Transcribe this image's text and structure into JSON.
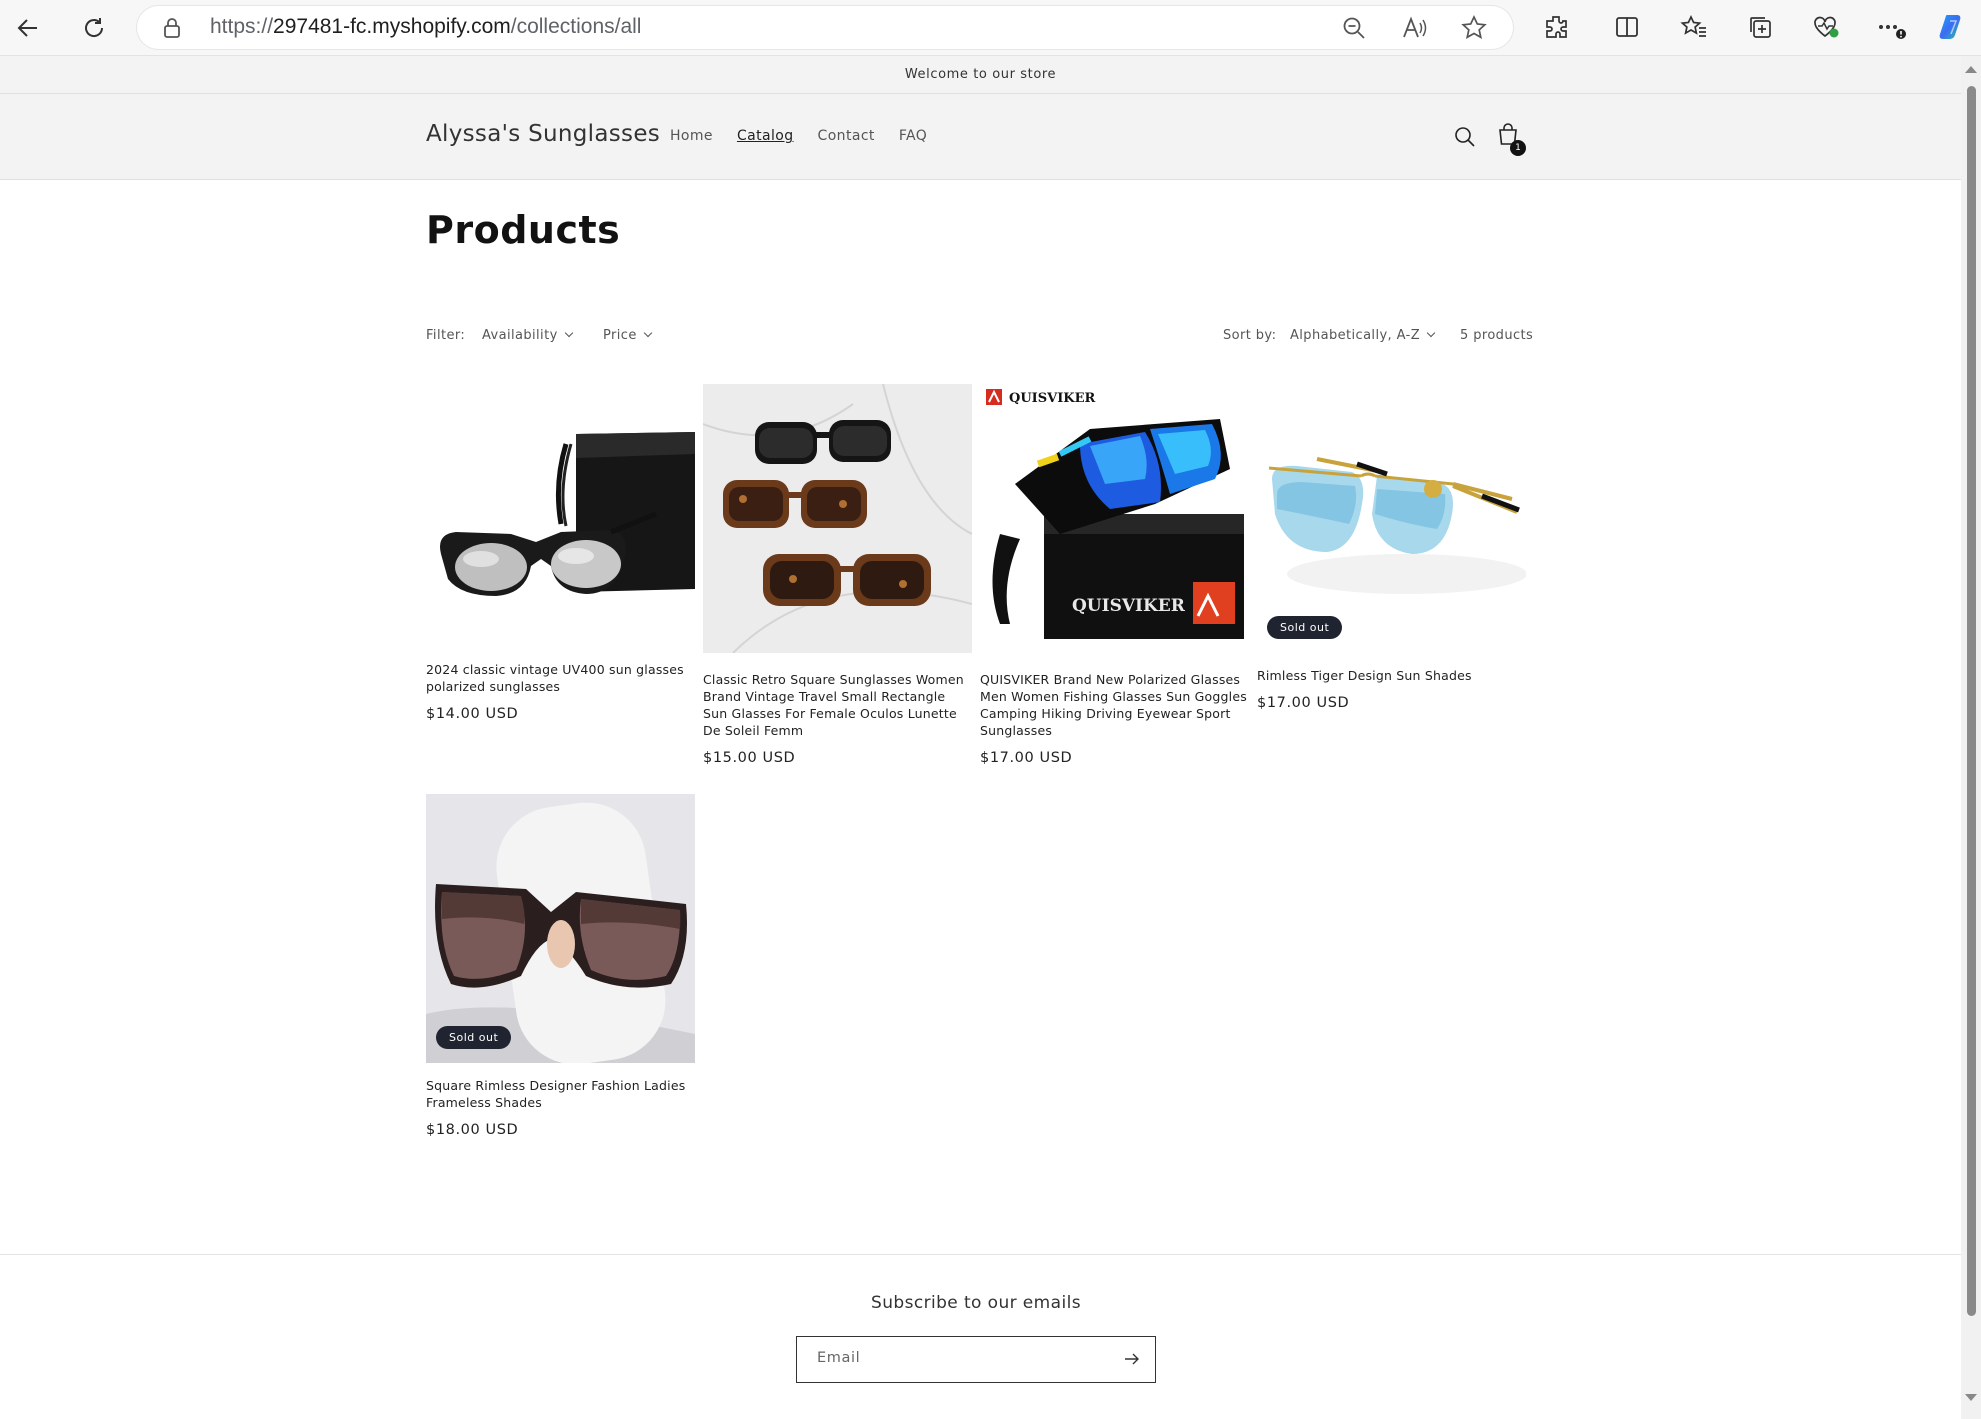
{
  "browser": {
    "url_prefix": "https://",
    "url_domain": "297481-fc.myshopify.com",
    "url_path": "/collections/all"
  },
  "store": {
    "announcement": "Welcome to our store",
    "name": "Alyssa's Sunglasses",
    "nav": [
      "Home",
      "Catalog",
      "Contact",
      "FAQ"
    ],
    "active_nav": "Catalog",
    "cart_count": "1"
  },
  "collection": {
    "title": "Products",
    "filter_label": "Filter:",
    "filters": [
      "Availability",
      "Price"
    ],
    "sort_label": "Sort by:",
    "sort_value": "Alphabetically, A-Z",
    "product_count": "5 products"
  },
  "products": [
    {
      "name": "2024 classic vintage UV400 sun glasses polarized sunglasses",
      "price": "$14.00 USD",
      "badge": ""
    },
    {
      "name": "Classic Retro Square Sunglasses Women Brand Vintage Travel Small Rectangle Sun Glasses For Female Oculos Lunette De Soleil Femm",
      "price": "$15.00 USD",
      "badge": ""
    },
    {
      "name": "QUISVIKER Brand New Polarized Glasses Men Women Fishing Glasses Sun Goggles Camping Hiking Driving Eyewear Sport Sunglasses",
      "price": "$17.00 USD",
      "badge": "",
      "brand_text": "QUISVIKER"
    },
    {
      "name": "Rimless Tiger Design Sun Shades",
      "price": "$17.00 USD",
      "badge": "Sold out"
    },
    {
      "name": "Square Rimless Designer Fashion Ladies Frameless Shades",
      "price": "$18.00 USD",
      "badge": "Sold out"
    }
  ],
  "footer": {
    "subscribe_title": "Subscribe to our emails",
    "email_placeholder": "Email"
  },
  "icons": [
    "back-icon",
    "refresh-icon",
    "lock-icon",
    "zoom-out-icon",
    "read-aloud-icon",
    "favorite-star-icon",
    "extensions-icon",
    "split-screen-icon",
    "favorites-icon",
    "collections-icon",
    "health-icon",
    "more-icon",
    "copilot-icon",
    "search-icon",
    "cart-icon",
    "arrow-right-icon"
  ]
}
